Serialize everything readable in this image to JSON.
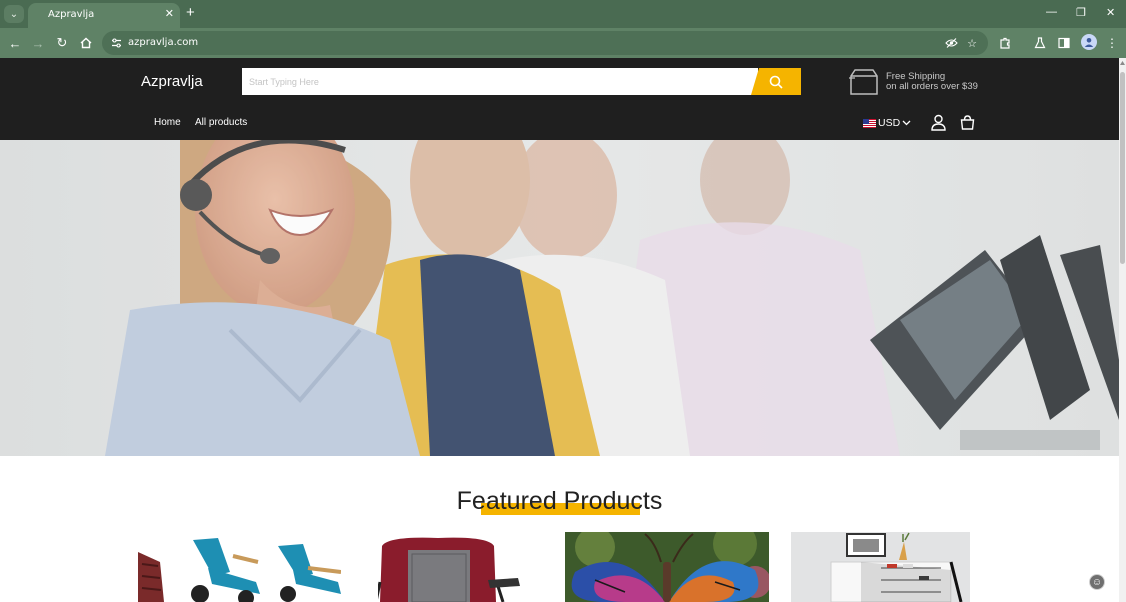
{
  "browser": {
    "tab_title": "Azpravlja",
    "url": "azpravlja.com"
  },
  "store": {
    "brand": "Azpravlja",
    "search_placeholder": "Start Typing Here",
    "shipping_line1": "Free Shipping",
    "shipping_line2": "on all orders over $39",
    "nav": [
      "Home",
      "All products"
    ],
    "currency": "USD",
    "accent_color": "#f5b400",
    "header_color": "#1f1f1f"
  },
  "featured": {
    "title": "Featured Products"
  },
  "icons": {
    "search": "search-icon",
    "shipping": "shipping-box-icon",
    "account": "user-icon",
    "cart": "cart-icon",
    "flag": "us-flag-icon"
  }
}
